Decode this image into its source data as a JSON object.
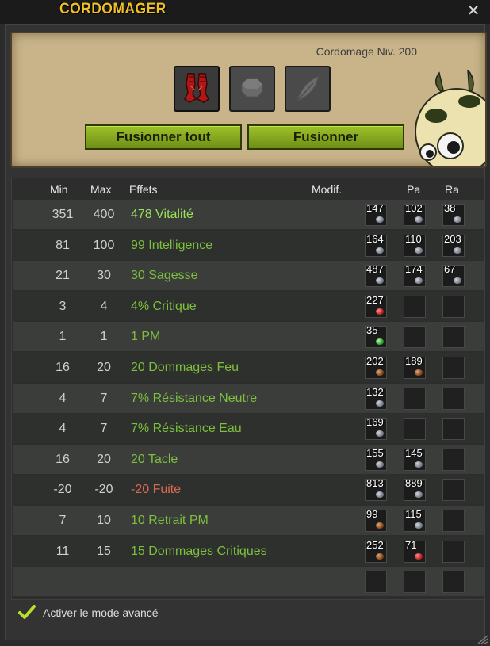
{
  "window": {
    "title": "CORDOMAGER",
    "close_icon": "close-icon"
  },
  "craft": {
    "level": "Cordomage Niv. 200",
    "slots": [
      "boots-item-icon",
      "runes-slot-icon",
      "feather-slot-icon"
    ],
    "fuse_all_label": "Fusionner tout",
    "fuse_label": "Fusionner"
  },
  "table": {
    "headers": {
      "min": "Min",
      "max": "Max",
      "effects": "Effets",
      "modif": "Modif.",
      "pa": "Pa",
      "ra": "Ra"
    },
    "rows": [
      {
        "min": "351",
        "max": "400",
        "effect": "478 Vitalité",
        "tone": "bright",
        "runes": [
          "147",
          "102",
          "38"
        ],
        "gems": [
          "silver",
          "silver",
          "silver"
        ]
      },
      {
        "min": "81",
        "max": "100",
        "effect": "99 Intelligence",
        "tone": "normal",
        "runes": [
          "164",
          "110",
          "203"
        ],
        "gems": [
          "silver",
          "silver",
          "silver"
        ]
      },
      {
        "min": "21",
        "max": "30",
        "effect": "30 Sagesse",
        "tone": "normal",
        "runes": [
          "487",
          "174",
          "67"
        ],
        "gems": [
          "silver",
          "silver",
          "silver"
        ]
      },
      {
        "min": "3",
        "max": "4",
        "effect": "4% Critique",
        "tone": "normal",
        "runes": [
          "227",
          "",
          ""
        ],
        "gems": [
          "red",
          "",
          ""
        ]
      },
      {
        "min": "1",
        "max": "1",
        "effect": "1 PM",
        "tone": "normal",
        "runes": [
          "35",
          "",
          ""
        ],
        "gems": [
          "green",
          "",
          ""
        ]
      },
      {
        "min": "16",
        "max": "20",
        "effect": "20 Dommages Feu",
        "tone": "normal",
        "runes": [
          "202",
          "189",
          ""
        ],
        "gems": [
          "brown",
          "brown",
          ""
        ]
      },
      {
        "min": "4",
        "max": "7",
        "effect": "7% Résistance Neutre",
        "tone": "normal",
        "runes": [
          "132",
          "",
          ""
        ],
        "gems": [
          "silver",
          "",
          ""
        ]
      },
      {
        "min": "4",
        "max": "7",
        "effect": "7% Résistance Eau",
        "tone": "normal",
        "runes": [
          "169",
          "",
          ""
        ],
        "gems": [
          "silver",
          "",
          ""
        ]
      },
      {
        "min": "16",
        "max": "20",
        "effect": "20 Tacle",
        "tone": "normal",
        "runes": [
          "155",
          "145",
          ""
        ],
        "gems": [
          "silver",
          "silver",
          ""
        ]
      },
      {
        "min": "-20",
        "max": "-20",
        "effect": "-20 Fuite",
        "tone": "negative",
        "runes": [
          "813",
          "889",
          ""
        ],
        "gems": [
          "silver",
          "silver",
          ""
        ]
      },
      {
        "min": "7",
        "max": "10",
        "effect": "10 Retrait PM",
        "tone": "normal",
        "runes": [
          "99",
          "115",
          ""
        ],
        "gems": [
          "brown",
          "silver",
          ""
        ]
      },
      {
        "min": "11",
        "max": "15",
        "effect": "15 Dommages Critiques",
        "tone": "normal",
        "runes": [
          "252",
          "71",
          ""
        ],
        "gems": [
          "brown",
          "red",
          ""
        ]
      },
      {
        "min": "",
        "max": "",
        "effect": "",
        "tone": "normal",
        "runes": [
          "",
          "",
          ""
        ],
        "gems": [
          "",
          "",
          ""
        ]
      }
    ]
  },
  "footer": {
    "advanced_mode_label": "Activer le mode avancé",
    "advanced_mode_checked": true
  },
  "colors": {
    "title": "#f0c02a",
    "effect_green": "#7dbf3e",
    "effect_bright": "#9be25a",
    "effect_negative": "#d86a52",
    "button": "#8aad20"
  }
}
